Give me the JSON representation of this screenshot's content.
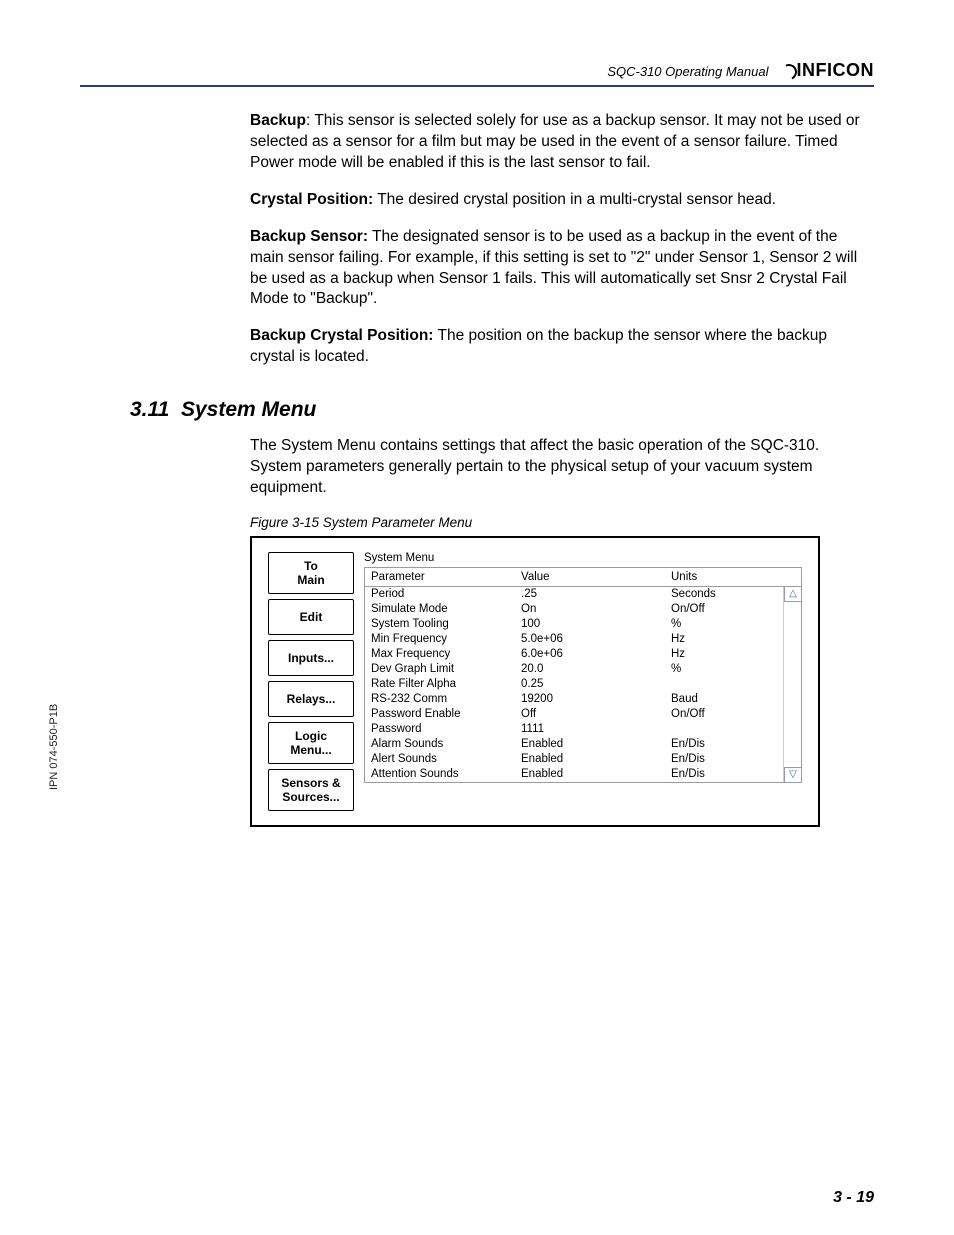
{
  "header": {
    "doc_title": "SQC-310 Operating Manual",
    "logo_text": "INFICON"
  },
  "ipn": "IPN 074-550-P1B",
  "page_number": "3 - 19",
  "body": {
    "backup_label": "Backup",
    "backup_text": ": This sensor is selected solely for use as a backup sensor. It may not be used or selected as a sensor for a film but may be used in the event of a sensor failure. Timed Power mode will be enabled if this is the last sensor to fail.",
    "crystal_pos_label": "Crystal Position:",
    "crystal_pos_text": " The desired crystal position in a multi-crystal sensor head.",
    "backup_sensor_label": "Backup Sensor:",
    "backup_sensor_text": " The designated sensor is to be used as a backup in the event of the main sensor failing. For example, if this setting is set to \"2\" under Sensor 1, Sensor 2 will be used as a backup when Sensor 1 fails. This will automatically set Snsr 2 Crystal Fail Mode to \"Backup\".",
    "backup_crystal_label": "Backup Crystal Position:",
    "backup_crystal_text": " The position on the backup the sensor where the backup crystal is located."
  },
  "section": {
    "number": "3.11",
    "title": "System Menu",
    "intro": "The System Menu contains settings that affect the basic operation of the SQC-310. System parameters generally pertain to the physical setup of your vacuum system equipment.",
    "figure_caption": "Figure 3-15  System Parameter Menu"
  },
  "figure": {
    "side_buttons": [
      "To\nMain",
      "Edit",
      "Inputs...",
      "Relays...",
      "Logic\nMenu...",
      "Sensors &\nSources..."
    ],
    "panel_title": "System Menu",
    "columns": {
      "param": "Parameter",
      "value": "Value",
      "units": "Units"
    },
    "rows": [
      {
        "param": "Period",
        "value": ".25",
        "units": "Seconds"
      },
      {
        "param": "Simulate Mode",
        "value": "On",
        "units": "On/Off"
      },
      {
        "param": "System Tooling",
        "value": "100",
        "units": "%"
      },
      {
        "param": "Min Frequency",
        "value": "5.0e+06",
        "units": "Hz"
      },
      {
        "param": "Max Frequency",
        "value": "6.0e+06",
        "units": "Hz"
      },
      {
        "param": "Dev Graph Limit",
        "value": "20.0",
        "units": "%"
      },
      {
        "param": "Rate Filter Alpha",
        "value": "0.25",
        "units": ""
      },
      {
        "param": "RS-232 Comm",
        "value": "19200",
        "units": "Baud"
      },
      {
        "param": "Password Enable",
        "value": "Off",
        "units": "On/Off"
      },
      {
        "param": "Password",
        "value": "1111",
        "units": ""
      },
      {
        "param": "Alarm Sounds",
        "value": "Enabled",
        "units": "En/Dis"
      },
      {
        "param": "Alert Sounds",
        "value": "Enabled",
        "units": "En/Dis"
      },
      {
        "param": "Attention Sounds",
        "value": "Enabled",
        "units": "En/Dis"
      }
    ]
  }
}
